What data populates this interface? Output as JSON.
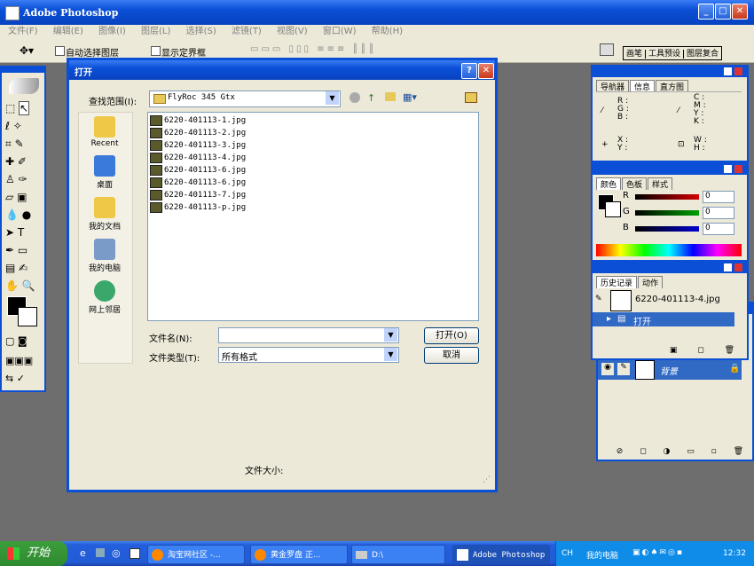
{
  "photoshop": {
    "title": "Adobe Photoshop",
    "menu": [
      "文件(F)",
      "编辑(E)",
      "图像(I)",
      "图层(L)",
      "选择(S)",
      "滤镜(T)",
      "视图(V)",
      "窗口(W)",
      "帮助(H)"
    ],
    "options": {
      "auto_select": "自动选择图层",
      "show_bounds": "显示定界框"
    },
    "well_tabs": [
      "画笔",
      "工具预设",
      "图层复合"
    ]
  },
  "nav_palette": {
    "tabs": [
      "导航器",
      "信息",
      "直方图"
    ],
    "rgb_labels": [
      "R :",
      "G :",
      "B :"
    ],
    "cmyk_labels": [
      "C :",
      "M :",
      "Y :",
      "K :"
    ],
    "xy_labels": [
      "X :",
      "Y :"
    ],
    "wh_labels": [
      "W :",
      "H :"
    ]
  },
  "color_palette": {
    "tabs": [
      "颜色",
      "色板",
      "样式"
    ],
    "channels": [
      {
        "label": "R",
        "value": "0",
        "color": "#d40000"
      },
      {
        "label": "G",
        "value": "0",
        "color": "#00a000"
      },
      {
        "label": "B",
        "value": "0",
        "color": "#0000d0"
      }
    ]
  },
  "history_palette": {
    "tabs": [
      "历史记录",
      "动作"
    ],
    "snapshot": "6220-401113-4.jpg",
    "step": "打开"
  },
  "layers_palette": {
    "layer_name": "背景"
  },
  "dialog": {
    "title": "打开",
    "look_in_label": "查找范围(I):",
    "look_in_value": "FlyRoc 345 Gtx",
    "places": [
      "Recent",
      "桌面",
      "我的文档",
      "我的电脑",
      "网上邻居"
    ],
    "files": [
      "6220-401113-1.jpg",
      "6220-401113-2.jpg",
      "6220-401113-3.jpg",
      "6220-401113-4.jpg",
      "6220-401113-6.jpg",
      "6220-401113-6.jpg",
      "6220-401113-7.jpg",
      "6220-401113-p.jpg"
    ],
    "filename_label": "文件名(N):",
    "filename_value": "",
    "filetype_label": "文件类型(T):",
    "filetype_value": "所有格式",
    "open_button": "打开(O)",
    "cancel_button": "取消",
    "filesize_label": "文件大小:"
  },
  "taskbar": {
    "start": "开始",
    "tasks": [
      "淘宝网社区 -...",
      "黄金罗盘 正...",
      "D:\\",
      "Adobe Photoshop"
    ],
    "lang": "CH",
    "mycomputer": "我的电脑",
    "clock": "12:32"
  }
}
